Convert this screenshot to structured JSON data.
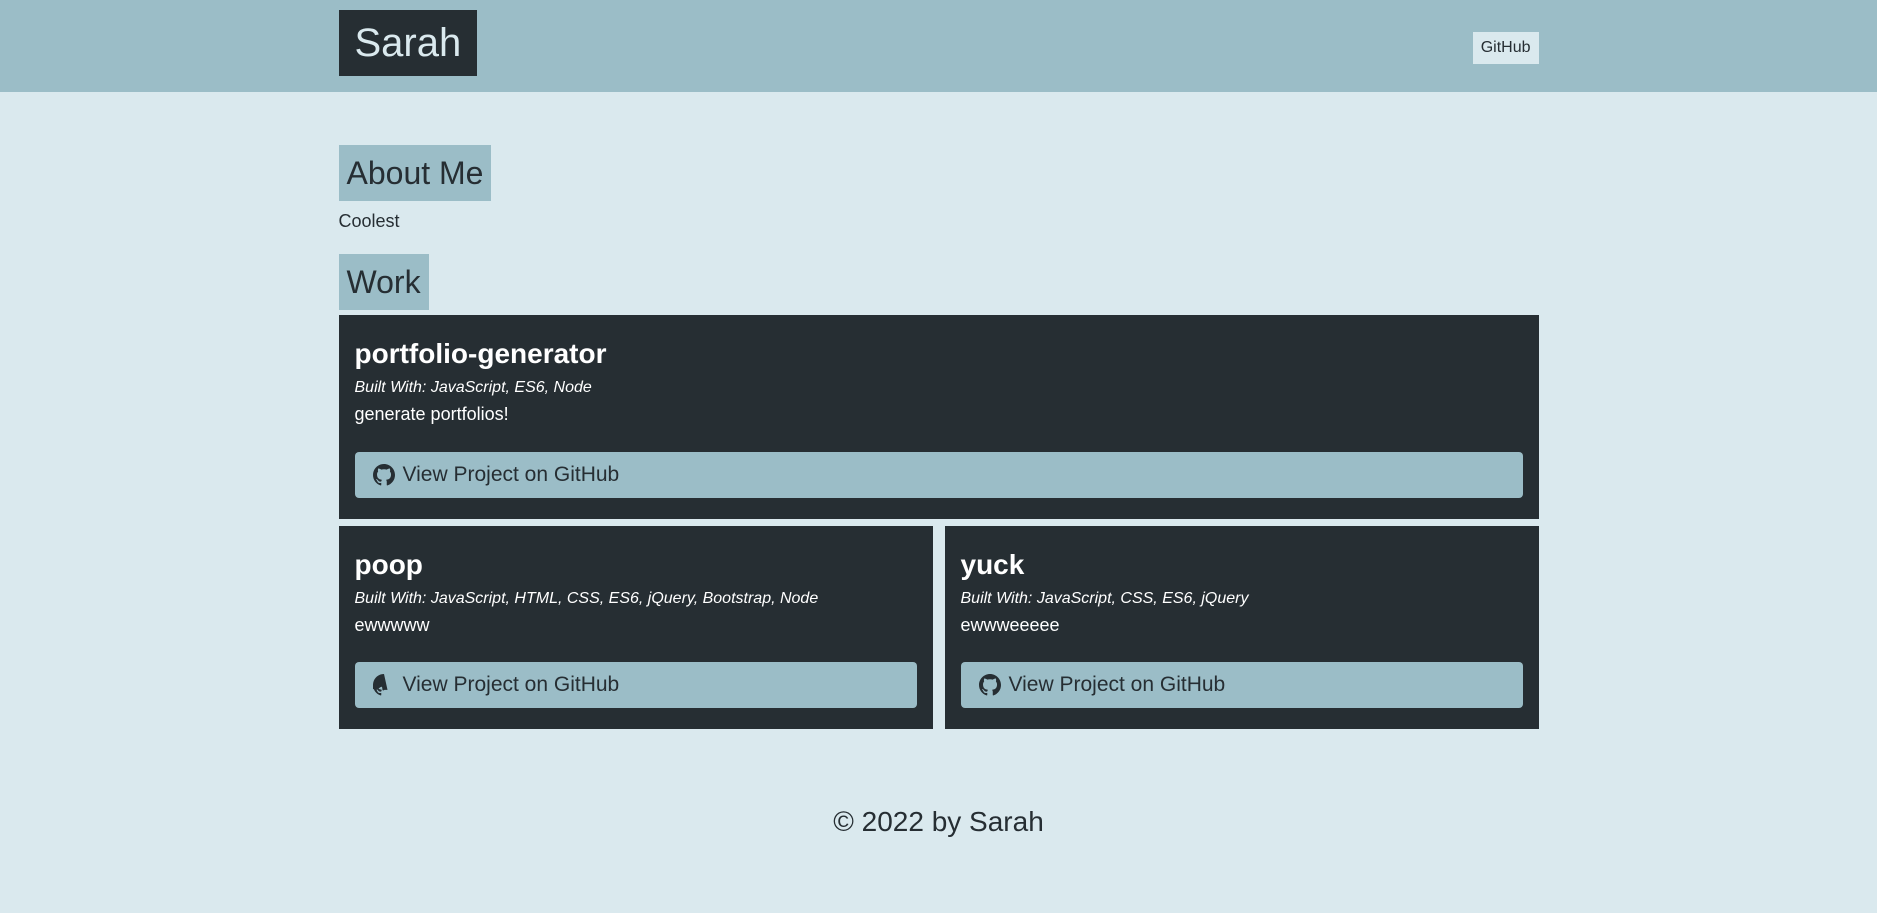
{
  "header": {
    "brand": "Sarah",
    "nav_link": "GitHub"
  },
  "about": {
    "heading": "About Me",
    "text": "Coolest"
  },
  "work": {
    "heading": "Work",
    "projects": [
      {
        "title": "portfolio-generator",
        "built_with": "Built With: JavaScript, ES6, Node",
        "description": "generate portfolios!",
        "button_label": "View Project on GitHub"
      },
      {
        "title": "poop",
        "built_with": "Built With: JavaScript, HTML, CSS, ES6, jQuery, Bootstrap, Node",
        "description": "ewwwww",
        "button_label": "View Project on GitHub"
      },
      {
        "title": "yuck",
        "built_with": "Built With: JavaScript, CSS, ES6, jQuery",
        "description": "ewwweeeee",
        "button_label": "View Project on GitHub"
      }
    ]
  },
  "footer": {
    "text": "© 2022 by Sarah"
  },
  "icons": {
    "project_button_icon": "github-icon"
  },
  "colors": {
    "header_bg": "#9bbdc7",
    "page_bg": "#dae9ee",
    "dark": "#262e33",
    "accent": "#9bbdc7"
  }
}
